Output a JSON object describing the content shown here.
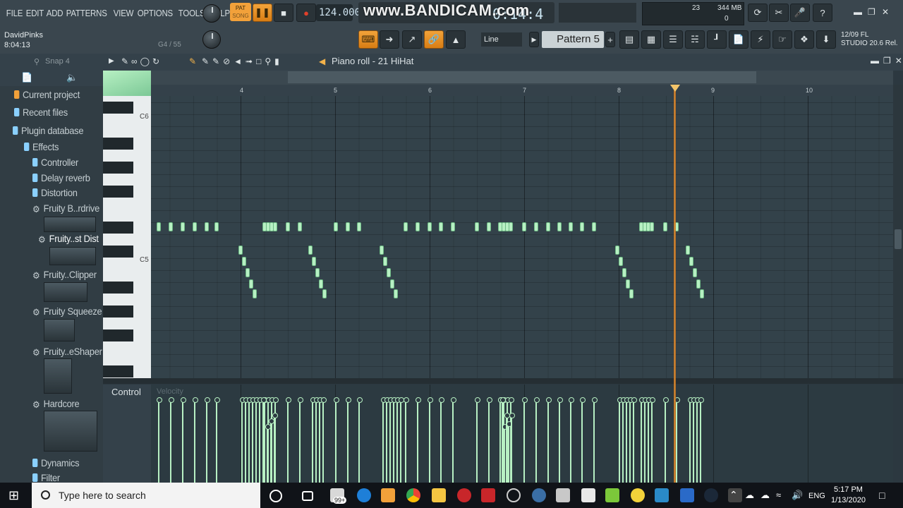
{
  "menu": [
    "FILE",
    "EDIT",
    "ADD",
    "PATTERNS",
    "VIEW",
    "OPTIONS",
    "TOOLS",
    "HELP"
  ],
  "hint": {
    "user": "DavidPinks",
    "time": "8:04:13",
    "note_pos": "G4 / 55"
  },
  "transport": {
    "pat_label": "PAT",
    "song_label": "SONG",
    "tempo": "124.000",
    "time_display": "0:14:4"
  },
  "watermark": "www.BANDICAM.com",
  "monitor": {
    "voices": "23",
    "memory": "344 MB",
    "zero": "0"
  },
  "snap": "Line",
  "pattern": "Pattern 5",
  "version": {
    "line1": "12/09  FL",
    "line2": "STUDIO 20.6 Rel."
  },
  "browser": {
    "snap_label": "Snap 4",
    "items": [
      {
        "label": "Current project",
        "icon": "project-icon"
      },
      {
        "label": "Recent files",
        "icon": "folder-icon"
      },
      {
        "label": "Plugin database",
        "icon": "plugin-icon"
      },
      {
        "label": "Effects",
        "icon": "folder-icon"
      },
      {
        "label": "Controller",
        "icon": "folder-icon"
      },
      {
        "label": "Delay reverb",
        "icon": "folder-icon"
      },
      {
        "label": "Distortion",
        "icon": "folder-icon"
      },
      {
        "label": "Fruity B..rdrive",
        "icon": "plugin-gear-icon"
      },
      {
        "label": "Fruity..st Dist",
        "icon": "plugin-gear-icon"
      },
      {
        "label": "Fruity..Clipper",
        "icon": "plugin-gear-icon"
      },
      {
        "label": "Fruity Squeeze",
        "icon": "plugin-gear-icon"
      },
      {
        "label": "Fruity..eShaper",
        "icon": "plugin-gear-icon"
      },
      {
        "label": "Hardcore",
        "icon": "plugin-gear-icon"
      },
      {
        "label": "Dynamics",
        "icon": "folder-icon"
      },
      {
        "label": "Filter",
        "icon": "folder-icon"
      }
    ]
  },
  "piano_roll": {
    "title": "Piano roll - 21 HiHat",
    "bars": [
      "4",
      "5",
      "6",
      "7",
      "8",
      "9",
      "10"
    ],
    "keys": [
      "C6",
      "C5"
    ],
    "control_label": "Control",
    "control_target": "Velocity"
  },
  "taskbar": {
    "search_placeholder": "Type here to search",
    "lang": "ENG",
    "time": "5:17 PM",
    "date": "1/13/2020",
    "badge": "99+"
  },
  "colors": {
    "accent": "#f2a13a",
    "note": "#b7f0c3",
    "grid": "#33424a"
  }
}
